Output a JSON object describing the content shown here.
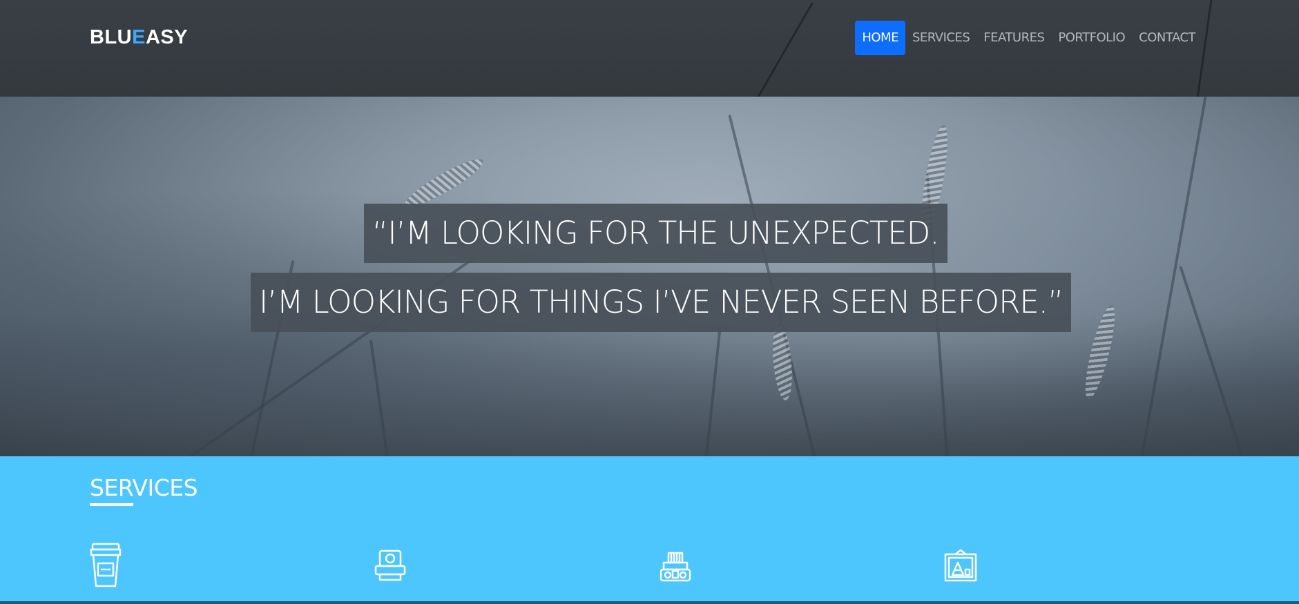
{
  "header": {
    "logo_part1": "BLU",
    "logo_part2": "E",
    "logo_part3": "ASY",
    "nav": [
      {
        "label": "HOME",
        "active": true
      },
      {
        "label": "SERVICES",
        "active": false
      },
      {
        "label": "FEATURES",
        "active": false
      },
      {
        "label": "PORTFOLIO",
        "active": false
      },
      {
        "label": "CONTACT",
        "active": false
      }
    ]
  },
  "hero": {
    "quote_line_1": "“I’M LOOKING FOR THE UNEXPECTED.",
    "quote_line_2": "I’M LOOKING FOR THINGS I’VE NEVER SEEN BEFORE.”"
  },
  "services": {
    "title": "SERVICES",
    "icons": [
      "coffee-cup-icon",
      "instant-camera-icon",
      "film-projector-icon",
      "framed-picture-icon"
    ]
  },
  "colors": {
    "nav_active_bg": "#0d6efd",
    "logo_accent": "#3ba9ff",
    "services_bg": "#4cc6fd",
    "header_bg": "#383d43"
  }
}
